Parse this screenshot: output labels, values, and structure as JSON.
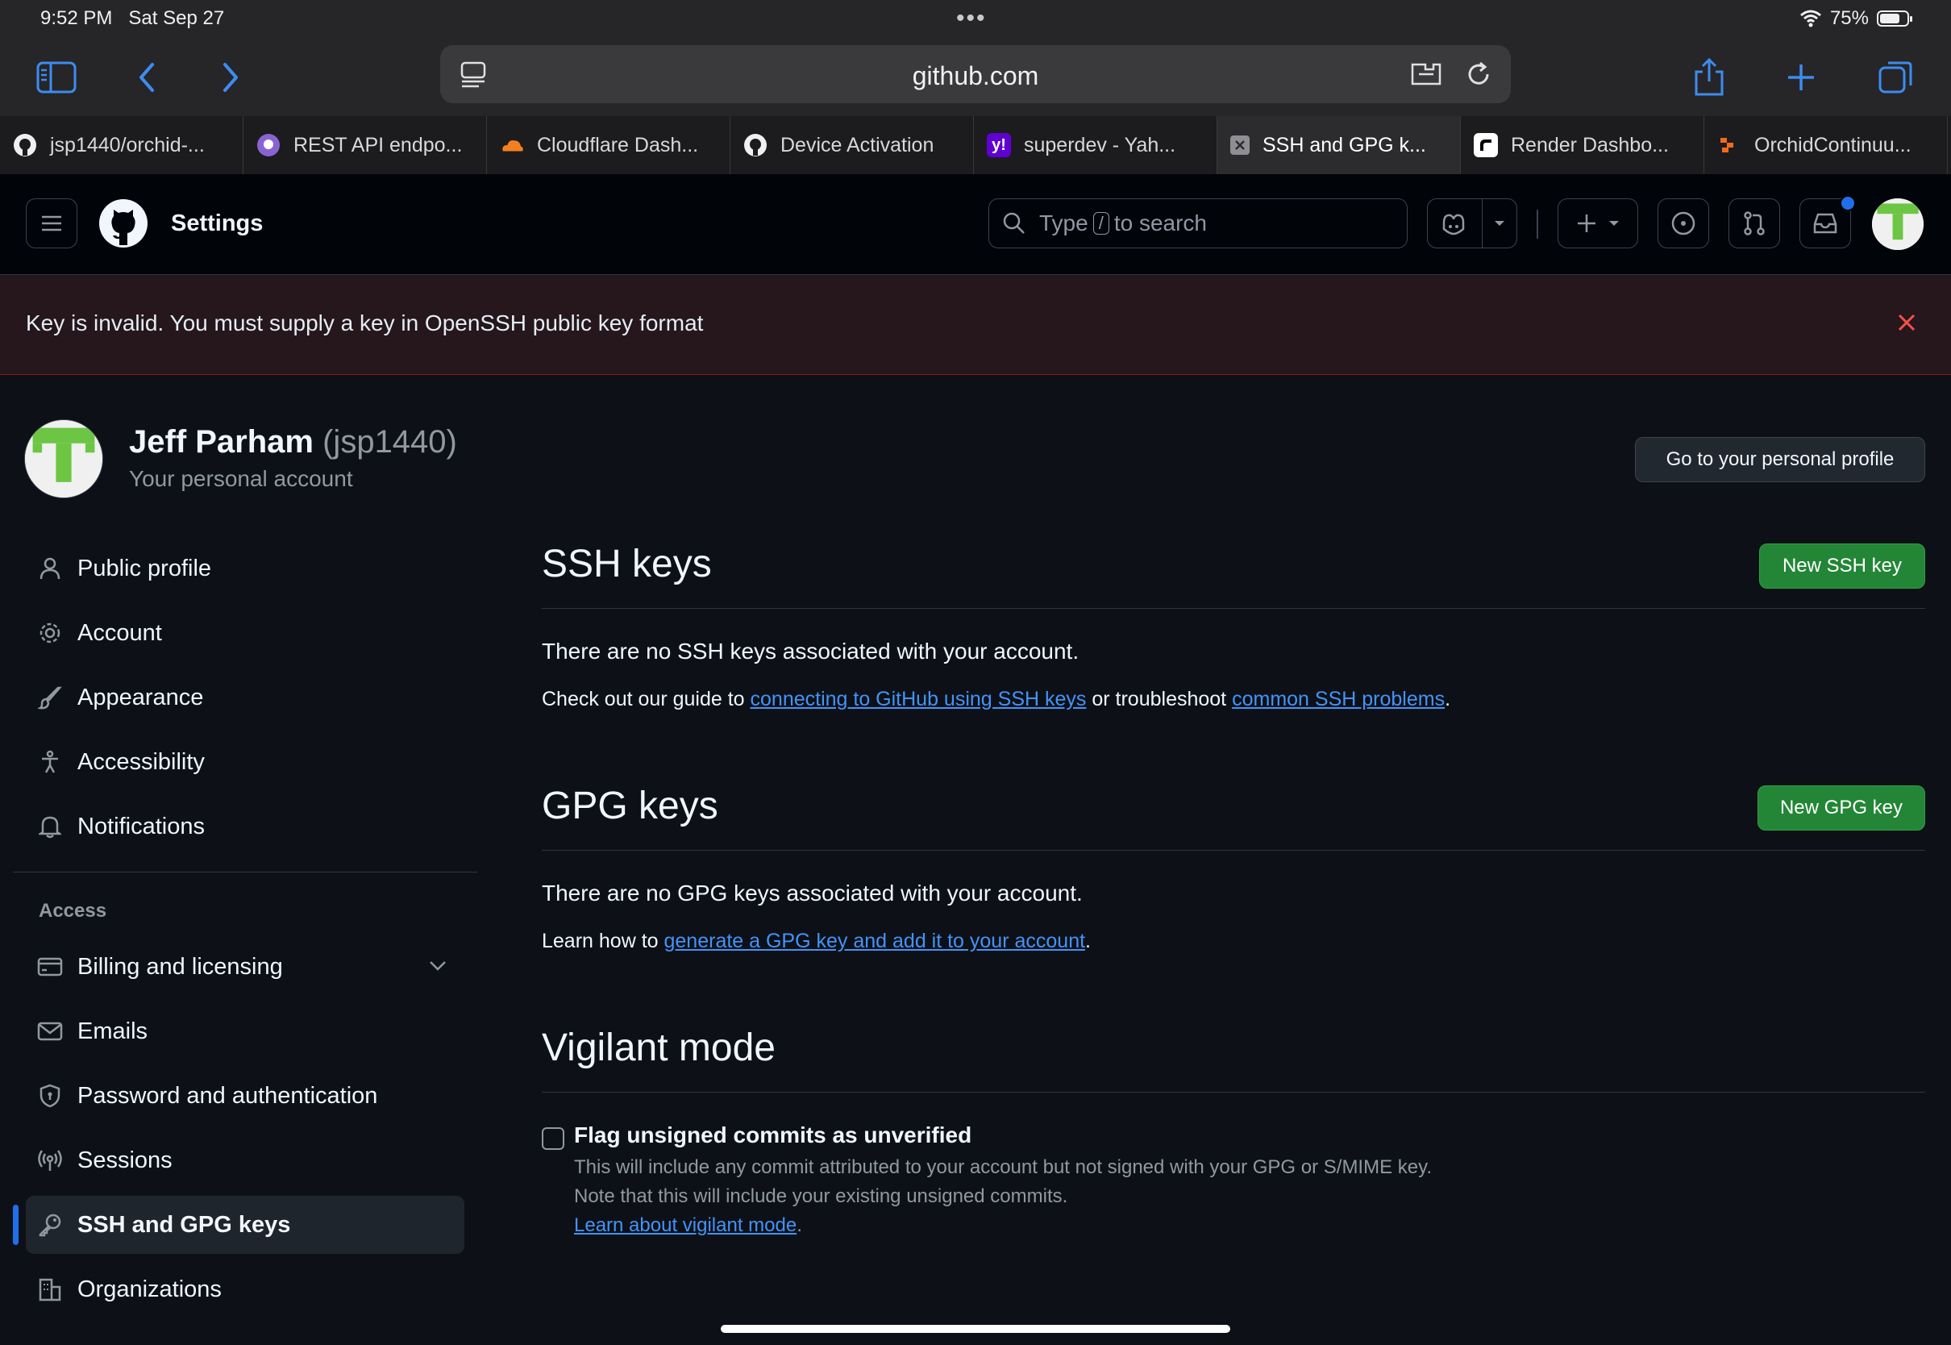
{
  "status_bar": {
    "time": "9:52 PM",
    "date": "Sat Sep 27",
    "battery": "75%",
    "battery_level": 0.75,
    "more_icon": "ellipsis-icon"
  },
  "browser": {
    "url": "github.com",
    "tabs": [
      {
        "title": "jsp1440/orchid-...",
        "icon": "github-icon"
      },
      {
        "title": "REST API endpo...",
        "icon": "github-docs-icon"
      },
      {
        "title": "Cloudflare Dash...",
        "icon": "cloudflare-icon"
      },
      {
        "title": "Device Activation",
        "icon": "github-icon"
      },
      {
        "title": "superdev - Yah...",
        "icon": "yahoo-icon"
      },
      {
        "title": "SSH and GPG k...",
        "icon": "close-tab-icon",
        "active": true
      },
      {
        "title": "Render Dashbo...",
        "icon": "render-icon"
      },
      {
        "title": "OrchidContinuu...",
        "icon": "orchid-icon"
      }
    ]
  },
  "header": {
    "title": "Settings",
    "search_prefix": "Type",
    "search_key": "/",
    "search_suffix": "to search"
  },
  "flash": {
    "message": "Key is invalid. You must supply a key in OpenSSH public key format"
  },
  "profile": {
    "name": "Jeff Parham",
    "login": "(jsp1440)",
    "subtitle": "Your personal account",
    "go_button": "Go to your personal profile"
  },
  "sidebar": {
    "items": [
      {
        "label": "Public profile",
        "icon": "person-icon"
      },
      {
        "label": "Account",
        "icon": "gear-icon"
      },
      {
        "label": "Appearance",
        "icon": "paintbrush-icon"
      },
      {
        "label": "Accessibility",
        "icon": "accessibility-icon"
      },
      {
        "label": "Notifications",
        "icon": "bell-icon"
      }
    ],
    "access_heading": "Access",
    "access_items": [
      {
        "label": "Billing and licensing",
        "icon": "credit-card-icon"
      },
      {
        "label": "Emails",
        "icon": "mail-icon"
      },
      {
        "label": "Password and authentication",
        "icon": "shield-icon"
      },
      {
        "label": "Sessions",
        "icon": "broadcast-icon"
      },
      {
        "label": "SSH and GPG keys",
        "icon": "key-icon",
        "selected": true
      },
      {
        "label": "Organizations",
        "icon": "organization-icon"
      }
    ]
  },
  "ssh": {
    "title": "SSH keys",
    "button": "New SSH key",
    "empty": "There are no SSH keys associated with your account.",
    "guide_prefix": "Check out our guide to",
    "guide_link": "connecting to GitHub using SSH keys",
    "guide_middle": "or troubleshoot",
    "guide_link2": "common SSH problems",
    "guide_suffix": "."
  },
  "gpg": {
    "title": "GPG keys",
    "button": "New GPG key",
    "empty": "There are no GPG keys associated with your account.",
    "learn_prefix": "Learn how to",
    "learn_link": "generate a GPG key and add it to your account",
    "learn_suffix": "."
  },
  "vigilant": {
    "title": "Vigilant mode",
    "checkbox_label": "Flag unsigned commits as unverified",
    "checked": false,
    "desc1": "This will include any commit attributed to your account but not signed with your GPG or S/MIME key.",
    "desc2": "Note that this will include your existing unsigned commits.",
    "link": "Learn about vigilant mode",
    "link_suffix": "."
  },
  "colors": {
    "accent": "#1f6feb",
    "success": "#238636",
    "danger": "#f85149",
    "link": "#4493f8"
  }
}
